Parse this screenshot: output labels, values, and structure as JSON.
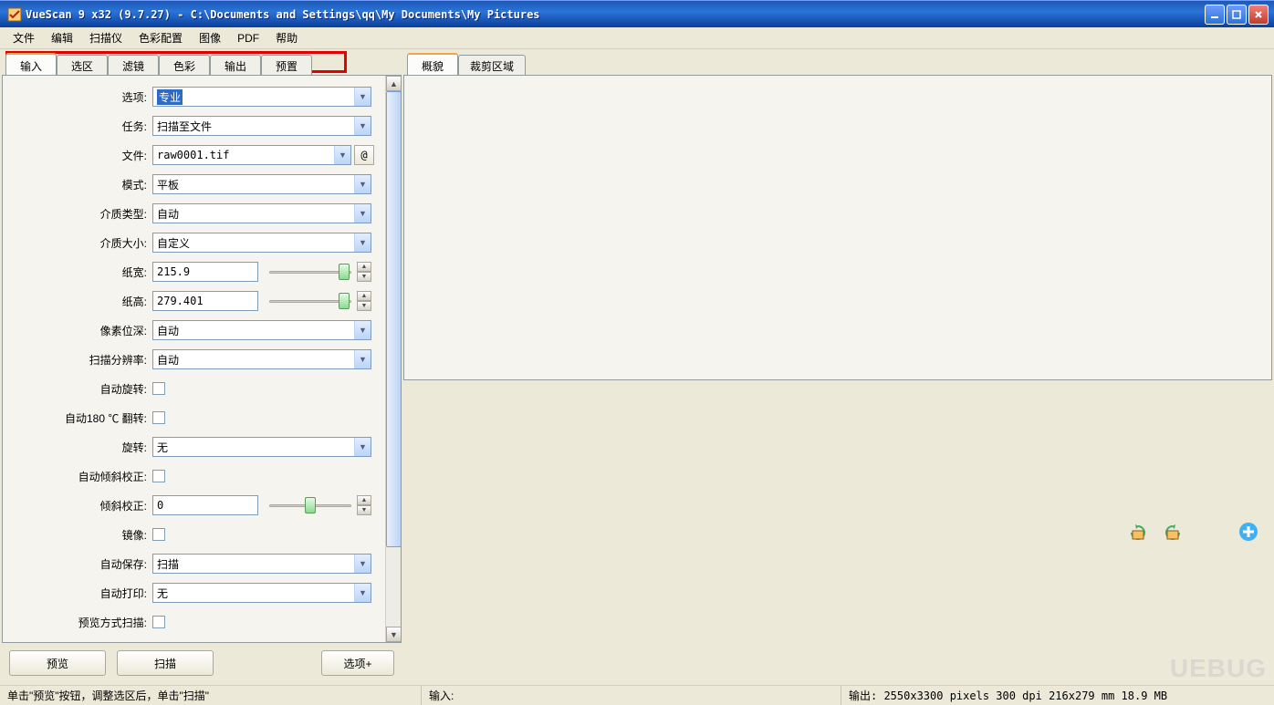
{
  "titlebar": {
    "title": "VueScan 9 x32 (9.7.27) - C:\\Documents and Settings\\qq\\My Documents\\My Pictures"
  },
  "menu": {
    "items": [
      "文件",
      "编辑",
      "扫描仪",
      "色彩配置",
      "图像",
      "PDF",
      "帮助"
    ]
  },
  "left_tabs": [
    "输入",
    "选区",
    "滤镜",
    "色彩",
    "输出",
    "预置"
  ],
  "right_tabs": [
    "概貌",
    "裁剪区域"
  ],
  "form": {
    "options_label": "选项:",
    "options_value": "专业",
    "task_label": "任务:",
    "task_value": "扫描至文件",
    "file_label": "文件:",
    "file_value": "raw0001.tif",
    "at_label": "@",
    "mode_label": "模式:",
    "mode_value": "平板",
    "media_type_label": "介质类型:",
    "media_type_value": "自动",
    "media_size_label": "介质大小:",
    "media_size_value": "自定义",
    "width_label": "纸宽:",
    "width_value": "215.9",
    "height_label": "纸高:",
    "height_value": "279.401",
    "bit_depth_label": "像素位深:",
    "bit_depth_value": "自动",
    "resolution_label": "扫描分辨率:",
    "resolution_value": "自动",
    "auto_rotate_label": "自动旋转:",
    "auto_180_label": "自动180 ℃ 翻转:",
    "rotate_label": "旋转:",
    "rotate_value": "无",
    "auto_deskew_label": "自动倾斜校正:",
    "deskew_label": "倾斜校正:",
    "deskew_value": "0",
    "mirror_label": "镜像:",
    "auto_save_label": "自动保存:",
    "auto_save_value": "扫描",
    "auto_print_label": "自动打印:",
    "auto_print_value": "无",
    "preview_scan_label": "预览方式扫描:"
  },
  "buttons": {
    "preview": "预览",
    "scan": "扫描",
    "options_plus": "选项+"
  },
  "status": {
    "hint": "单击\"预览\"按钮，调整选区后，单击\"扫描\"",
    "input_label": "输入:",
    "output": "输出: 2550x3300 pixels 300 dpi 216x279 mm 18.9 MB"
  },
  "watermark": "UEBUG"
}
